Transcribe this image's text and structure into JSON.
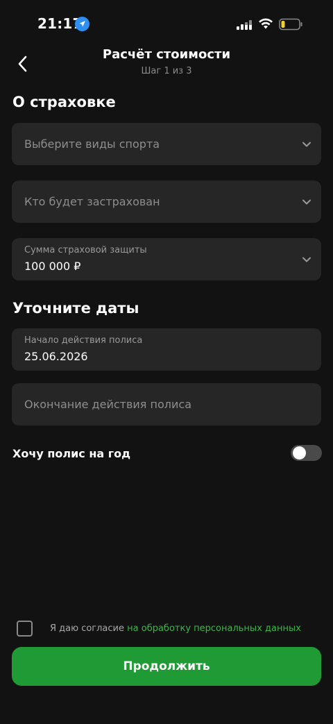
{
  "status_bar": {
    "time": "21:17",
    "icons": [
      "location-arrow-icon",
      "cellular-signal-icon",
      "wifi-icon",
      "battery-low-icon"
    ]
  },
  "header": {
    "title": "Расчёт стоимости",
    "subtitle": "Шаг 1 из 3",
    "back_icon": "chevron-left-icon"
  },
  "insurance_section": {
    "title": "О страховке",
    "sports_select": {
      "placeholder": "Выберите виды спорта"
    },
    "insured_select": {
      "placeholder": "Кто будет застрахован"
    },
    "coverage_select": {
      "label": "Сумма страховой защиты",
      "value": "100 000 ₽"
    }
  },
  "dates_section": {
    "title": "Уточните даты",
    "start_date": {
      "label": "Начало действия полиса",
      "value": "25.06.2026"
    },
    "end_date": {
      "placeholder": "Окончание действия полиса"
    }
  },
  "year_policy": {
    "label": "Хочу полис на год",
    "enabled": false
  },
  "consent": {
    "text": "Я даю согласие ",
    "link": "на обработку персональных данных",
    "checked": false
  },
  "continue_button": {
    "label": "Продолжить"
  },
  "colors": {
    "background": "#121212",
    "field": "#262626",
    "accent": "#1f9a35",
    "link": "#3bb54a"
  }
}
